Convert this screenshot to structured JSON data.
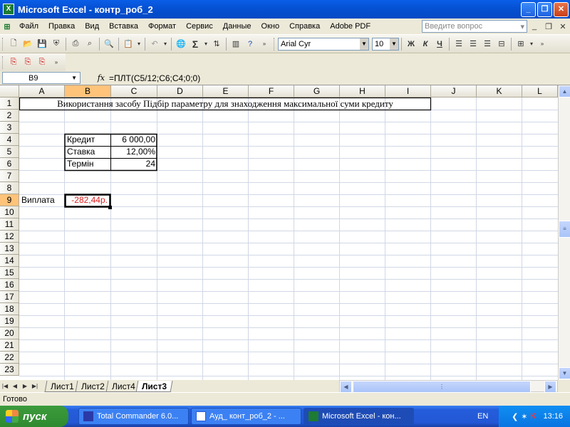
{
  "window": {
    "title": "Microsoft Excel - контр_роб_2"
  },
  "menu": {
    "items": [
      "Файл",
      "Правка",
      "Вид",
      "Вставка",
      "Формат",
      "Сервис",
      "Данные",
      "Окно",
      "Справка",
      "Adobe PDF"
    ],
    "help_placeholder": "Введите вопрос"
  },
  "toolbar": {
    "font": "Arial Cyr",
    "size": "10",
    "bold": "Ж",
    "italic": "К",
    "underline": "Ч"
  },
  "formula_bar": {
    "name_box": "B9",
    "fx": "fx",
    "formula": "=ПЛТ(C5/12;C6;C4;0;0)"
  },
  "columns": [
    "A",
    "B",
    "C",
    "D",
    "E",
    "F",
    "G",
    "H",
    "I",
    "J",
    "K",
    "L"
  ],
  "rows": [
    "1",
    "2",
    "3",
    "4",
    "5",
    "6",
    "7",
    "8",
    "9",
    "10",
    "11",
    "12",
    "13",
    "14",
    "15",
    "16",
    "17",
    "18",
    "19",
    "20",
    "21",
    "22",
    "23"
  ],
  "cells": {
    "title": "Використання засобу Підбір параметру для знаходження максимальної суми кредиту",
    "b4": "Кредит",
    "c4": "6 000,00",
    "b5": "Ставка",
    "c5": "12,00%",
    "b6": "Термін",
    "c6": "24",
    "a9": "Виплата",
    "b9": "-282,44р."
  },
  "sheets": [
    "Лист1",
    "Лист2",
    "Лист4",
    "Лист3"
  ],
  "active_sheet": "Лист3",
  "status": "Готово",
  "taskbar": {
    "start": "пуск",
    "tasks": [
      "Total Commander 6.0...",
      "Ауд_ конт_роб_2 - ...",
      "Microsoft Excel - кон..."
    ],
    "lang": "EN",
    "time": "13:16"
  }
}
